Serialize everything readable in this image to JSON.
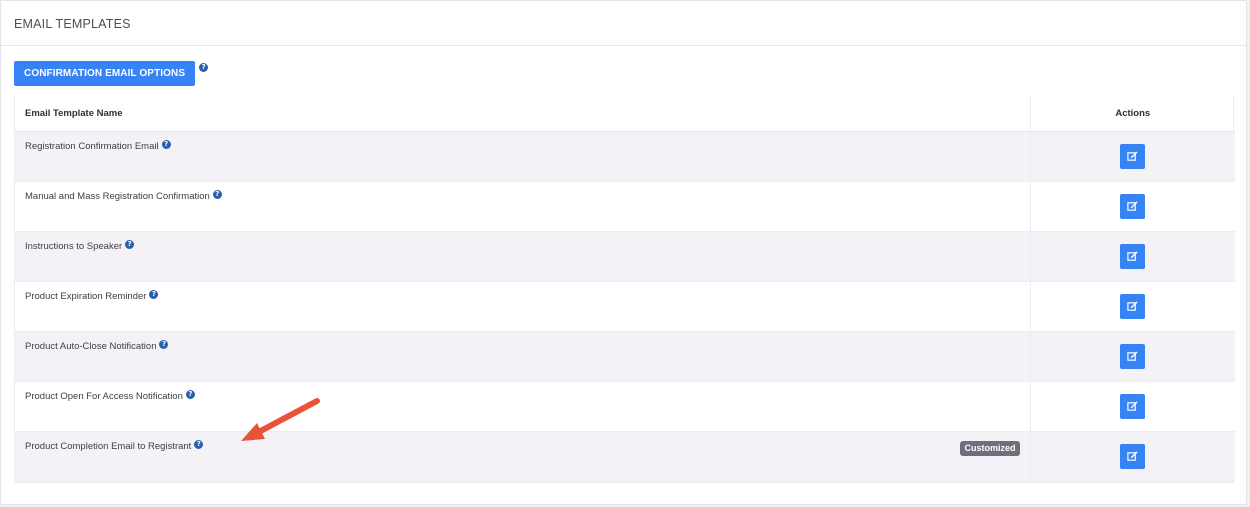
{
  "header": {
    "title": "EMAIL TEMPLATES"
  },
  "toolbar": {
    "button_label": "CONFIRMATION EMAIL OPTIONS"
  },
  "table": {
    "columns": [
      "Email Template Name",
      "Actions"
    ],
    "rows": [
      {
        "name": "Registration Confirmation Email",
        "badge": ""
      },
      {
        "name": "Manual and Mass Registration Confirmation",
        "badge": ""
      },
      {
        "name": "Instructions to Speaker",
        "badge": ""
      },
      {
        "name": "Product Expiration Reminder",
        "badge": ""
      },
      {
        "name": "Product Auto-Close Notification",
        "badge": ""
      },
      {
        "name": "Product Open For Access Notification",
        "badge": ""
      },
      {
        "name": "Product Completion Email to Registrant",
        "badge": "Customized"
      }
    ]
  },
  "icons": {
    "help": "question-circle-icon",
    "edit": "edit-pencil-icon",
    "annotation": "arrow-annotation"
  },
  "colors": {
    "primary": "#3683f5",
    "help_icon": "#2b5fad",
    "badge": "#6f6e7c",
    "row_alt": "#f4f2f7",
    "annotation_arrow": "#e8533a"
  }
}
